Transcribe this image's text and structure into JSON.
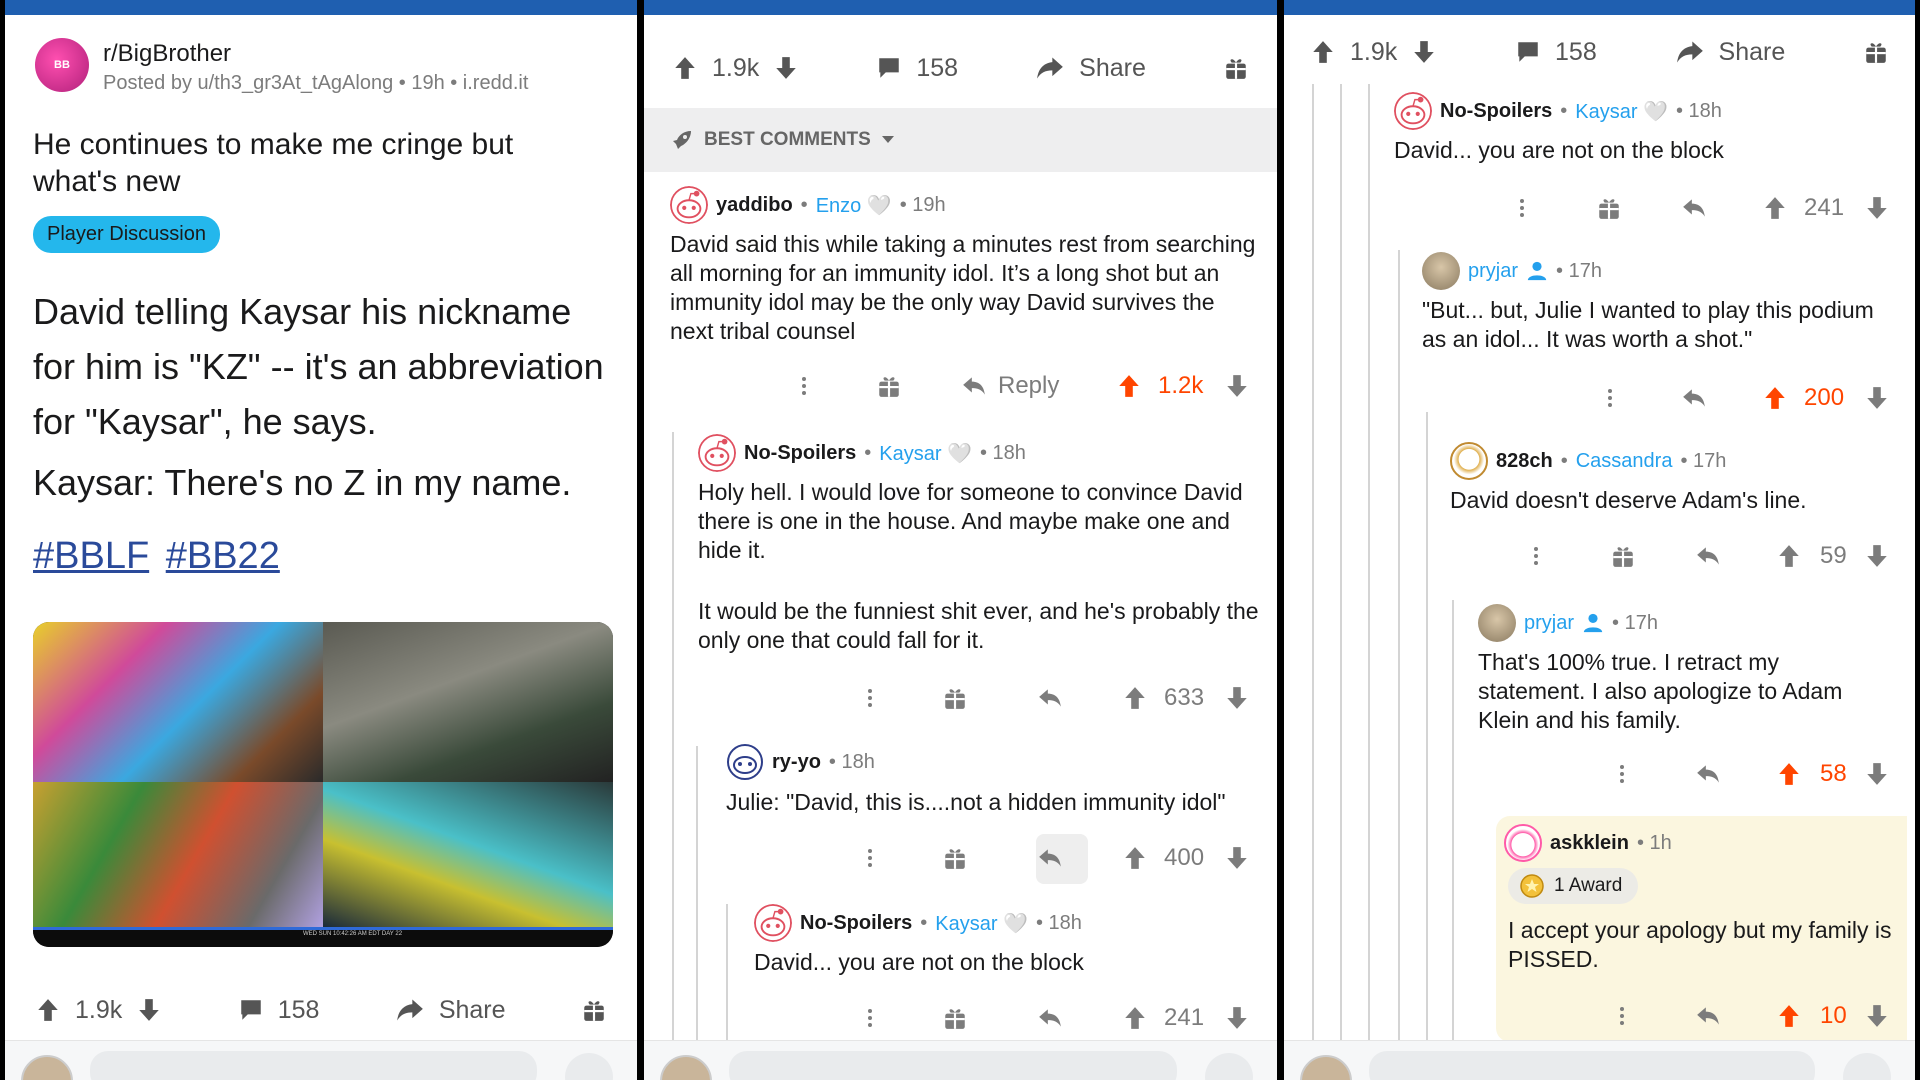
{
  "post": {
    "subreddit": "r/BigBrother",
    "meta": "Posted by u/th3_gr3At_tAgAlong • 19h • i.redd.it",
    "title": "He continues to make me cringe but what's new",
    "flair": "Player Discussion",
    "body_line1": "David telling Kaysar his nickname for him is \"KZ\" -- it's an abbreviation for \"Kaysar\", he says.",
    "body_line2": "Kaysar: There's no Z in my name.",
    "hashtag1": "#BBLF",
    "hashtag2": "#BB22",
    "image_caption": "WED SUN 10:42:26 AM EDT DAY 22",
    "score": "1.9k",
    "comments": "158",
    "share": "Share"
  },
  "sort": {
    "label": "BEST COMMENTS"
  },
  "comments": {
    "c1": {
      "user": "yaddibo",
      "flair": "Enzo 🤍",
      "time": "• 19h",
      "text": "David said this while taking a minutes rest from searching all morning for an immunity idol. It’s a long shot but an immunity idol may be the only way David survives the next tribal counsel",
      "reply": "Reply",
      "score": "1.2k"
    },
    "c2": {
      "user": "No-Spoilers",
      "flair": "Kaysar 🤍",
      "time": "• 18h",
      "text1": "Holy hell. I would love for someone to convince David there is one in the house. And maybe make one and hide it.",
      "text2": "It would be the funniest shit ever, and he's probably the only one that could fall for it.",
      "score": "633"
    },
    "c3": {
      "user": "ry-yo",
      "time": "• 18h",
      "text": "Julie: \"David, this is....not a hidden immunity idol\"",
      "score": "400"
    },
    "c4": {
      "user": "No-Spoilers",
      "flair": "Kaysar 🤍",
      "time": "• 18h",
      "text": "David... you are not on the block",
      "score": "241"
    },
    "c5": {
      "user": "pryjar",
      "time": "• 17h",
      "text": "\"But... but, Julie I wanted to play this podium as an idol... It was worth a shot.\"",
      "score": "200"
    },
    "c6": {
      "user": "828ch",
      "flair": "Cassandra",
      "time": "• 17h",
      "text": "David doesn't deserve Adam's line.",
      "score": "59"
    },
    "c7": {
      "user": "pryjar",
      "time": "• 17h",
      "text": "That's 100% true. I retract my statement. I also apologize to Adam Klein and his family.",
      "score": "58"
    },
    "c8": {
      "user": "askklein",
      "time": "• 1h",
      "award": "1 Award",
      "text": "I accept your apology but my family is PISSED.",
      "score": "10"
    }
  },
  "colors": {
    "accent_blue": "#1f5fb0",
    "upvote_orange": "#ff4500",
    "flair_blue": "#24a0ed",
    "award_bg": "#fbf6df"
  },
  "icons": [
    "upvote-icon",
    "downvote-icon",
    "comment-icon",
    "share-icon",
    "gift-icon",
    "reply-icon",
    "more-icon",
    "rocket-icon",
    "chevron-down-icon",
    "user-icon",
    "award-icon"
  ]
}
